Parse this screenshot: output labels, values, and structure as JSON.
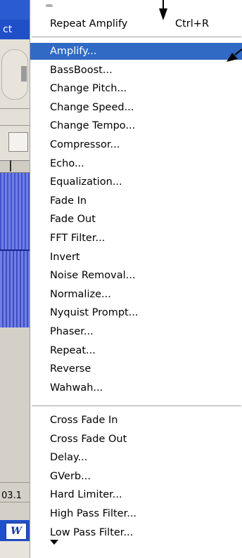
{
  "background_window": {
    "title_fragment": "ct",
    "time_fragment": "03.1",
    "taskbar_icon_letter": "W"
  },
  "menu": {
    "repeat_item": {
      "label": "Repeat Amplify",
      "shortcut": "Ctrl+R"
    },
    "items_group_1": [
      {
        "label": "Amplify...",
        "selected": true
      },
      {
        "label": "BassBoost..."
      },
      {
        "label": "Change Pitch..."
      },
      {
        "label": "Change Speed..."
      },
      {
        "label": "Change Tempo..."
      },
      {
        "label": "Compressor..."
      },
      {
        "label": "Echo..."
      },
      {
        "label": "Equalization..."
      },
      {
        "label": "Fade In"
      },
      {
        "label": "Fade Out"
      },
      {
        "label": "FFT Filter..."
      },
      {
        "label": "Invert"
      },
      {
        "label": "Noise Removal..."
      },
      {
        "label": "Normalize..."
      },
      {
        "label": "Nyquist Prompt..."
      },
      {
        "label": "Phaser..."
      },
      {
        "label": "Repeat..."
      },
      {
        "label": "Reverse"
      },
      {
        "label": "Wahwah..."
      }
    ],
    "items_group_2": [
      {
        "label": "Cross Fade In"
      },
      {
        "label": "Cross Fade Out"
      },
      {
        "label": "Delay..."
      },
      {
        "label": "GVerb..."
      },
      {
        "label": "Hard Limiter..."
      },
      {
        "label": "High Pass Filter..."
      },
      {
        "label": "Low Pass Filter..."
      }
    ],
    "more_indicator_icon": "triangle-down-icon"
  },
  "colors": {
    "selection": "#316ac5",
    "title_bar": "#2a5bd0",
    "waveform": "#6f7fe6"
  }
}
